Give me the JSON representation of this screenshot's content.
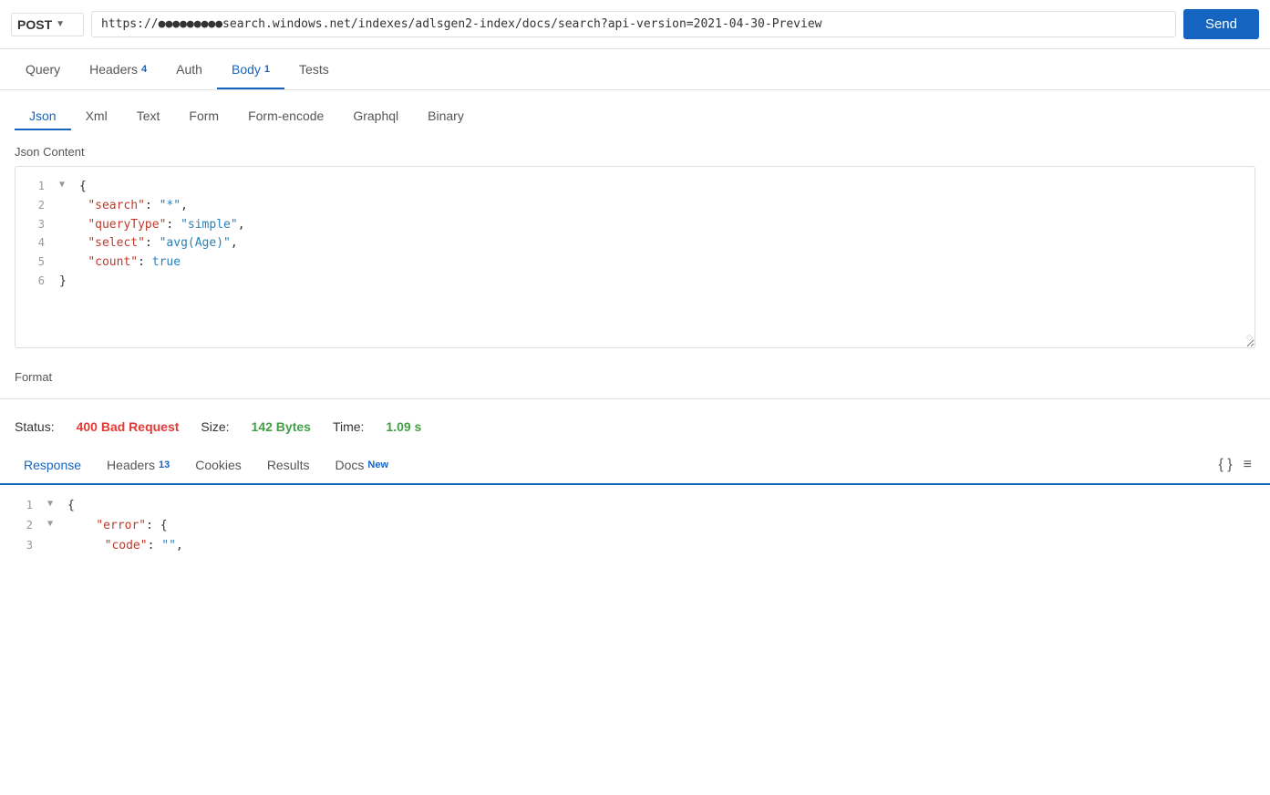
{
  "urlBar": {
    "method": "POST",
    "url": "https://●●●●●●●●●search.windows.net/indexes/adlsgen2-index/docs/search?api-version=2021-04-30-Preview",
    "sendLabel": "Send"
  },
  "topTabs": [
    {
      "id": "query",
      "label": "Query",
      "badge": null,
      "active": false
    },
    {
      "id": "headers",
      "label": "Headers",
      "badge": "4",
      "active": false
    },
    {
      "id": "auth",
      "label": "Auth",
      "badge": null,
      "active": false
    },
    {
      "id": "body",
      "label": "Body",
      "badge": "1",
      "active": true
    },
    {
      "id": "tests",
      "label": "Tests",
      "badge": null,
      "active": false
    }
  ],
  "bodyTabs": [
    {
      "id": "json",
      "label": "Json",
      "active": true
    },
    {
      "id": "xml",
      "label": "Xml",
      "active": false
    },
    {
      "id": "text",
      "label": "Text",
      "active": false
    },
    {
      "id": "form",
      "label": "Form",
      "active": false
    },
    {
      "id": "form-encode",
      "label": "Form-encode",
      "active": false
    },
    {
      "id": "graphql",
      "label": "Graphql",
      "active": false
    },
    {
      "id": "binary",
      "label": "Binary",
      "active": false
    }
  ],
  "jsonContent": {
    "label": "Json Content",
    "lines": [
      {
        "num": "1",
        "toggle": "▼",
        "content": "{"
      },
      {
        "num": "2",
        "content": "    \"search\": \"*\","
      },
      {
        "num": "3",
        "content": "    \"queryType\": \"simple\","
      },
      {
        "num": "4",
        "content": "    \"select\": \"avg(Age)\","
      },
      {
        "num": "5",
        "content": "    \"count\": true"
      },
      {
        "num": "6",
        "content": "}"
      }
    ]
  },
  "format": {
    "label": "Format"
  },
  "response": {
    "statusLabel": "Status:",
    "statusValue": "400 Bad Request",
    "sizeLabel": "Size:",
    "sizeValue": "142 Bytes",
    "timeLabel": "Time:",
    "timeValue": "1.09 s"
  },
  "responseTabs": [
    {
      "id": "response",
      "label": "Response",
      "badge": null,
      "active": true
    },
    {
      "id": "headers",
      "label": "Headers",
      "badge": "13",
      "active": false
    },
    {
      "id": "cookies",
      "label": "Cookies",
      "badge": null,
      "active": false
    },
    {
      "id": "results",
      "label": "Results",
      "badge": null,
      "active": false
    },
    {
      "id": "docs",
      "label": "Docs",
      "badge": "New",
      "active": false
    }
  ],
  "responseTools": {
    "jsonFormat": "{ }",
    "menu": "≡"
  },
  "responseLines": [
    {
      "num": "1",
      "toggle": "▼",
      "content": "{"
    },
    {
      "num": "2",
      "toggle": "▼",
      "content": "    \"error\": {"
    },
    {
      "num": "3",
      "content": "        \"code\": \"\","
    }
  ]
}
